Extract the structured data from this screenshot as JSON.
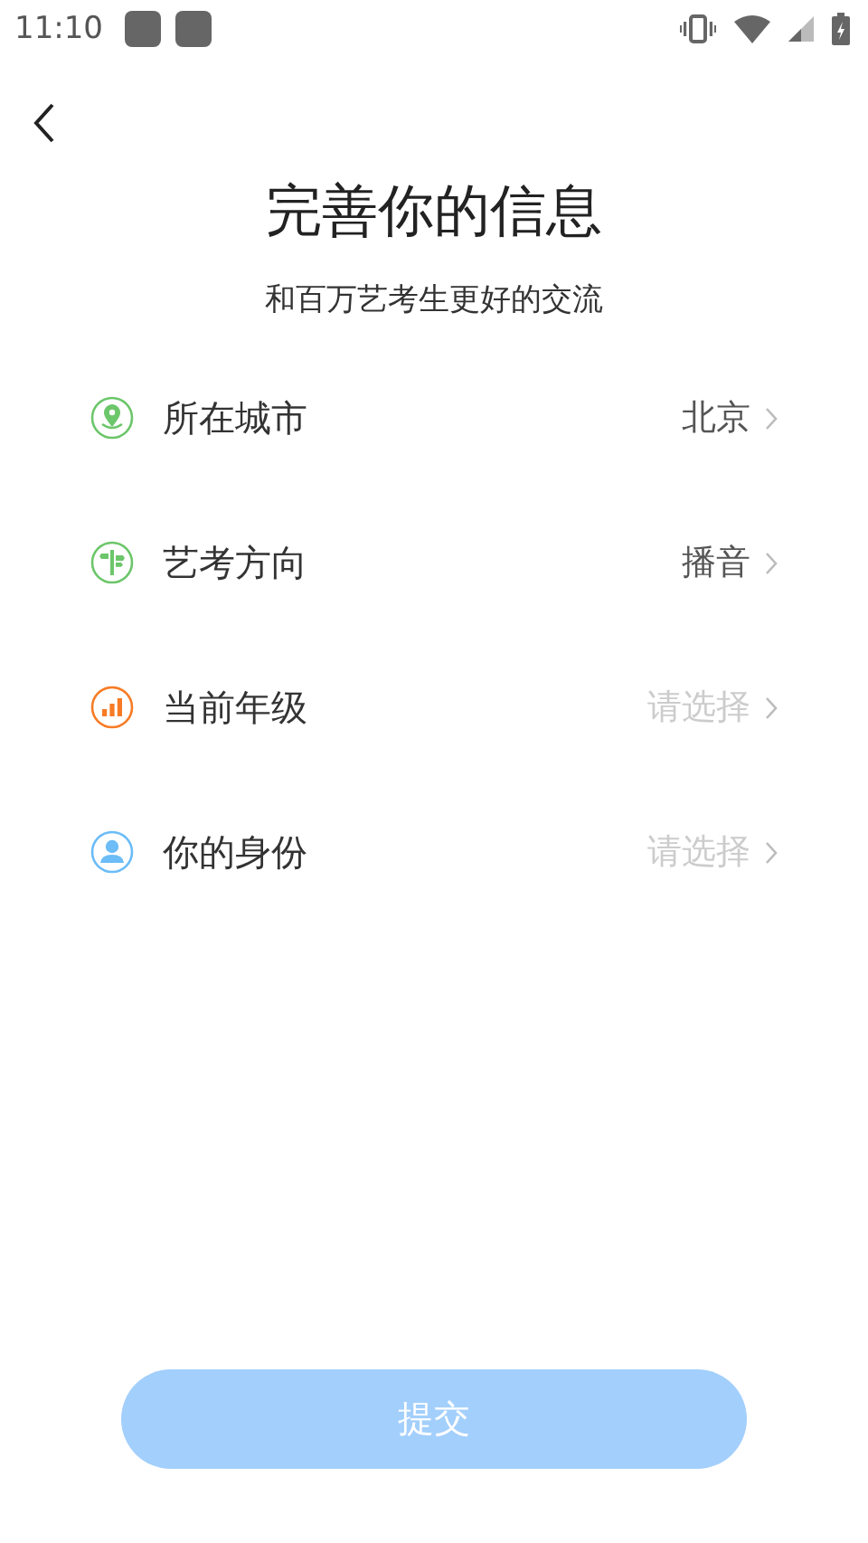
{
  "status_bar": {
    "time": "11:10"
  },
  "title": "完善你的信息",
  "subtitle": "和百万艺考生更好的交流",
  "fields": [
    {
      "kind": "location",
      "color": "#6cc66a",
      "label": "所在城市",
      "value": "北京"
    },
    {
      "kind": "signpost",
      "color": "#6cc66a",
      "label": "艺考方向",
      "value": "播音"
    },
    {
      "kind": "bars",
      "color": "#f77b25",
      "label": "当前年级",
      "placeholder": "请选择"
    },
    {
      "kind": "person",
      "color": "#6bbcf7",
      "label": "你的身份",
      "placeholder": "请选择"
    }
  ],
  "submit": {
    "label": "提交",
    "disabled": true
  }
}
